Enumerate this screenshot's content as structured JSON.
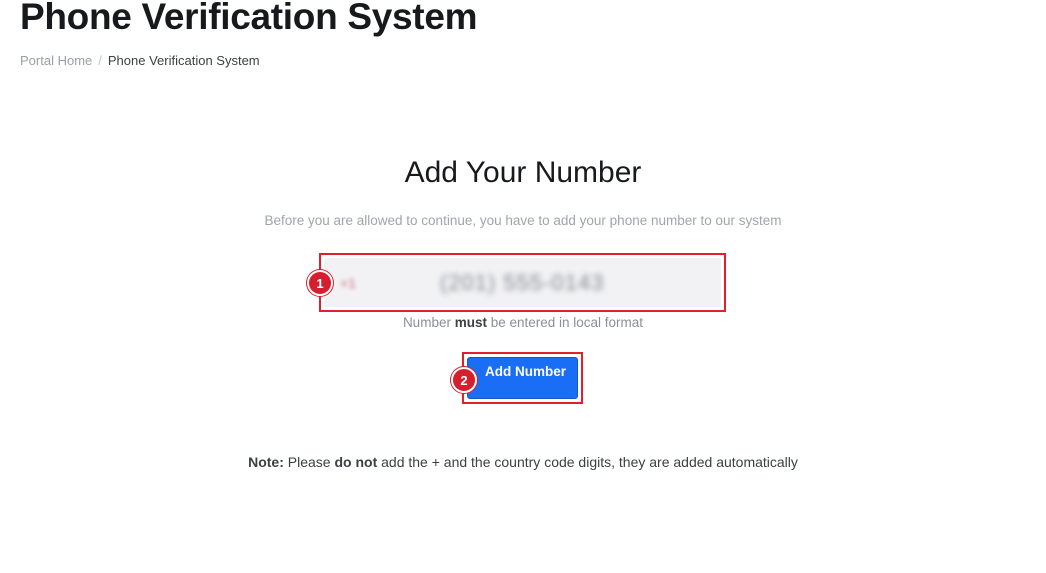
{
  "header": {
    "title": "Phone Verification System"
  },
  "breadcrumb": {
    "home": "Portal Home",
    "separator": "/",
    "current": "Phone Verification System"
  },
  "main": {
    "heading": "Add Your Number",
    "subtext": "Before you are allowed to continue, you have to add your phone number to our system",
    "phone_field": {
      "country_code": "+1",
      "value": "(201) 555-0143"
    },
    "hint": {
      "before": "Number ",
      "emphasis": "must",
      "after": " be entered in local format"
    },
    "add_button_label": "Add Number",
    "note": {
      "label": "Note:",
      "before": " Please ",
      "emphasis": "do not",
      "after": " add the + and the country code digits, they are added automatically"
    }
  },
  "annotations": {
    "step_1": "1",
    "step_2": "2"
  },
  "colors": {
    "accent": "#1a6ef5",
    "highlight": "#e0202f"
  }
}
